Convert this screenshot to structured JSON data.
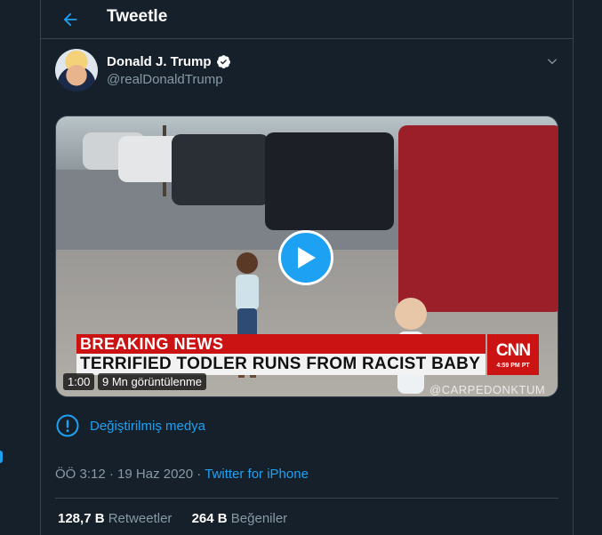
{
  "header": {
    "title": "Tweetle",
    "back_icon": "arrow-left-icon"
  },
  "tweet": {
    "author_name": "Donald J. Trump",
    "verified": true,
    "handle": "@realDonaldTrump",
    "media": {
      "breaking_label": "BREAKING NEWS",
      "headline": "TERRIFIED TODLER RUNS FROM RACIST BABY",
      "network_logo": "CNN",
      "broadcast_time": "4:59 PM PT",
      "watermark": "@CARPEDONKTUM",
      "duration": "1:00",
      "views": "9 Mn görüntülenme"
    },
    "media_notice": "Değiştirilmiş medya",
    "time": "ÖÖ 3:12",
    "date": "19 Haz 2020",
    "source": "Twitter for iPhone",
    "separator": "·",
    "retweets_count": "128,7 B",
    "retweets_label": "Retweetler",
    "likes_count": "264 B",
    "likes_label": "Beğeniler"
  },
  "colors": {
    "background": "#15202b",
    "accent": "#1da1f2",
    "muted": "#8899a6",
    "border": "#38444d"
  }
}
